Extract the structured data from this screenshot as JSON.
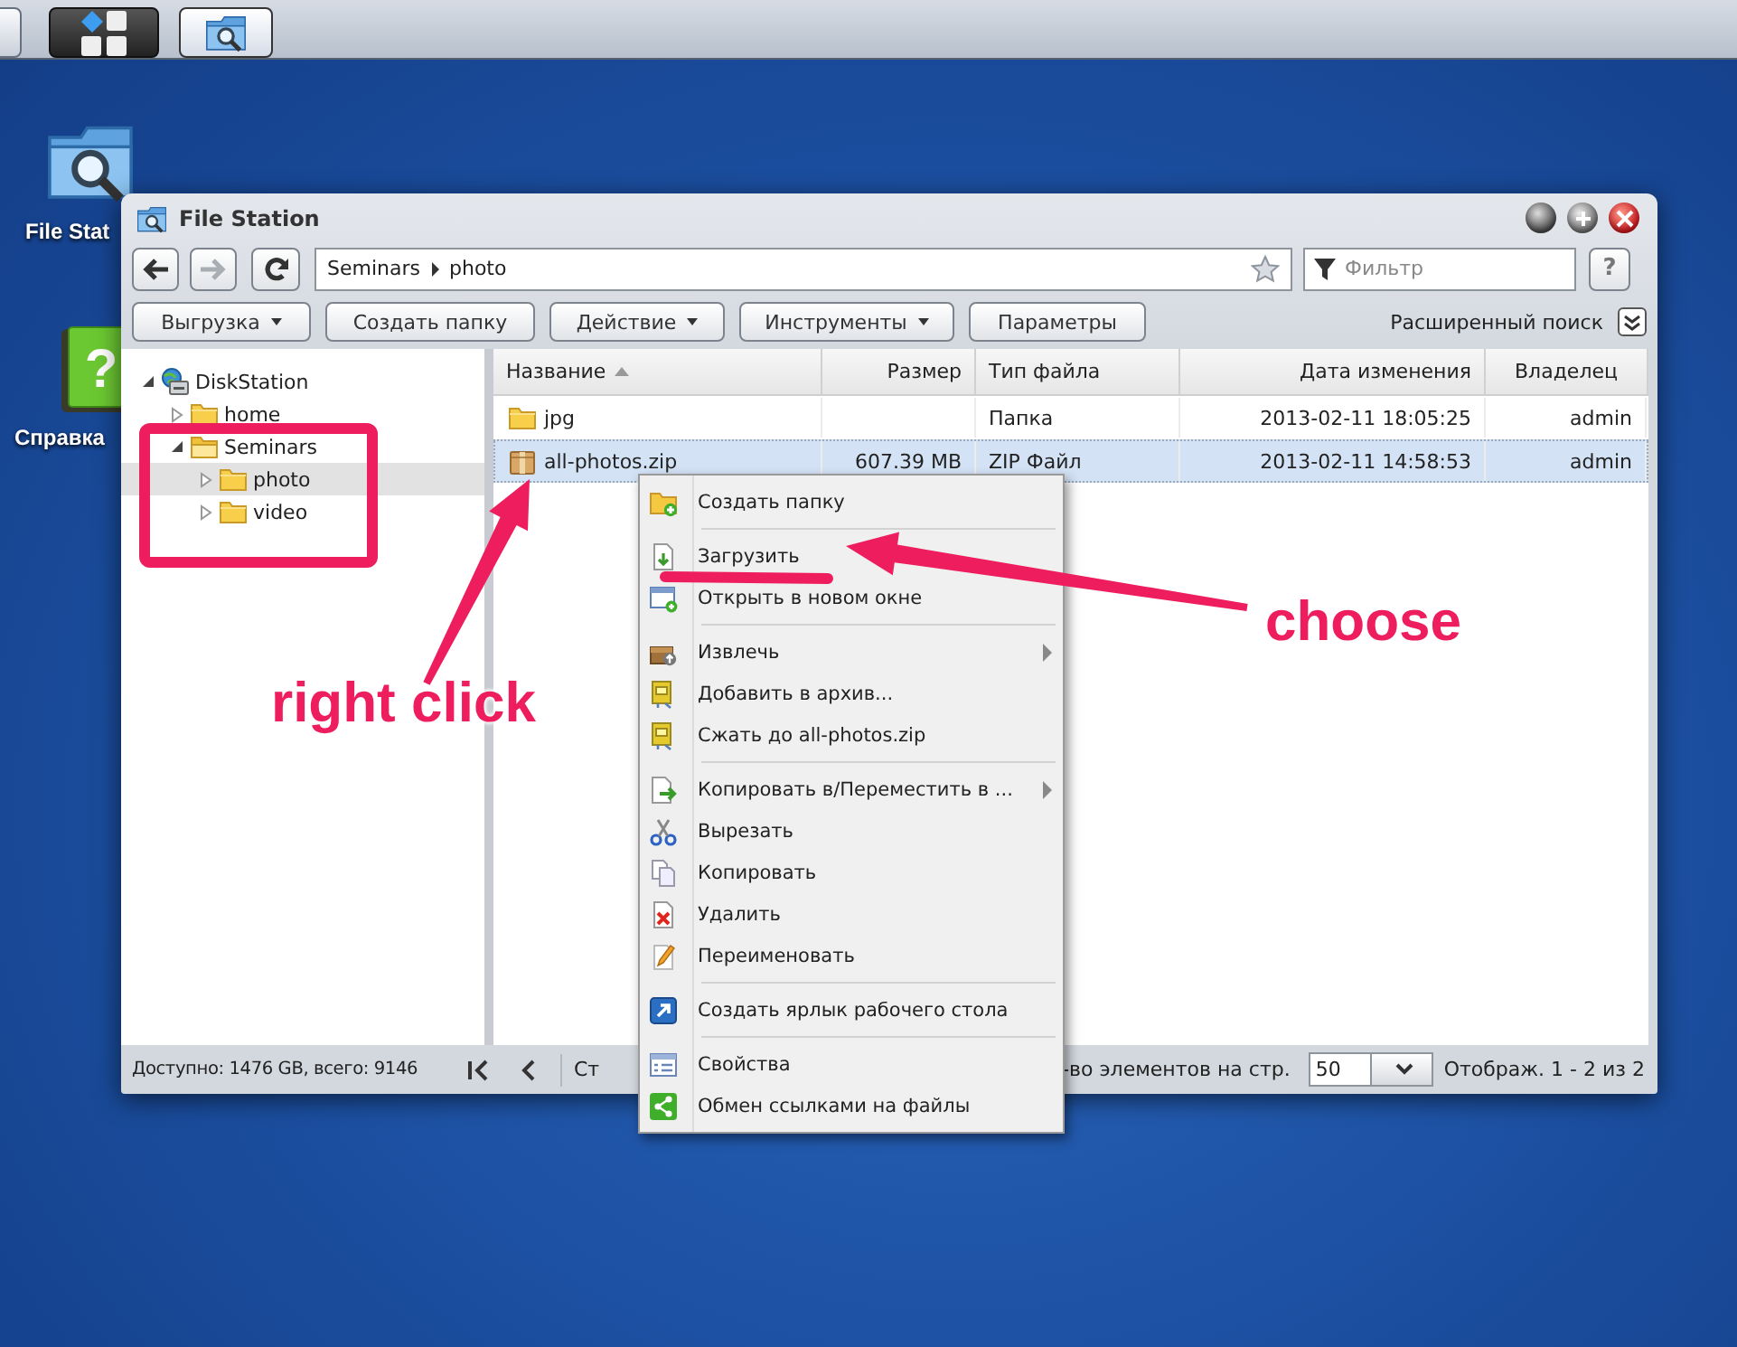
{
  "desktop_icons": [
    {
      "kind": "file-station",
      "label": "File Stat"
    },
    {
      "kind": "help",
      "label": "Справка",
      "glyph": "?"
    }
  ],
  "window": {
    "title": "File Station",
    "nav_buttons": [
      {
        "kind": "back",
        "disabled": false
      },
      {
        "kind": "forward",
        "disabled": true
      },
      {
        "kind": "refresh",
        "disabled": false
      }
    ],
    "path": [
      "Seminars",
      "photo"
    ],
    "filter": {
      "placeholder": "Фильтр"
    },
    "help": "?",
    "toolbar": {
      "buttons": [
        {
          "label": "Выгрузка",
          "dropdown": true
        },
        {
          "label": "Создать папку",
          "dropdown": false
        },
        {
          "label": "Действие",
          "dropdown": true
        },
        {
          "label": "Инструменты",
          "dropdown": true
        },
        {
          "label": "Параметры",
          "dropdown": false
        }
      ],
      "advanced_search": "Расширенный поиск"
    },
    "tree": [
      {
        "label": "DiskStation",
        "kind": "server",
        "expanded": true,
        "selected": false,
        "children": [
          {
            "label": "home",
            "kind": "folder",
            "expanded": false,
            "selected": false
          },
          {
            "label": "Seminars",
            "kind": "folder",
            "expanded": true,
            "selected": false,
            "children": [
              {
                "label": "photo",
                "kind": "folder",
                "expanded": false,
                "selected": true
              },
              {
                "label": "video",
                "kind": "folder",
                "expanded": false,
                "selected": false
              }
            ]
          }
        ]
      }
    ],
    "table": {
      "columns": [
        {
          "label": "Название",
          "sorted": true
        },
        {
          "label": "Размер",
          "sorted": false
        },
        {
          "label": "Тип файла",
          "sorted": false
        },
        {
          "label": "Дата изменения",
          "sorted": false
        },
        {
          "label": "Владелец",
          "sorted": false
        }
      ],
      "rows": [
        {
          "kind": "folder",
          "selected": false,
          "name": "jpg",
          "type": "Папка",
          "modified": "2013-02-11 18:05:25",
          "owner": "admin"
        },
        {
          "kind": "zip",
          "selected": true,
          "name": "all-photos.zip",
          "size": "607.39 MB",
          "type": "ZIP Файл",
          "modified": "2013-02-11 14:58:53",
          "owner": "admin"
        }
      ]
    },
    "status_bar": {
      "storage": "Доступно: 1476 GB, всего: 9146",
      "page_label": "Ст",
      "page_size_label": "-во элементов на стр.",
      "page_size": "50",
      "range": "Отображ. 1 - 2 из 2"
    }
  },
  "context_menu": {
    "groups": [
      [
        {
          "label": "Создать папку",
          "kind": "new-folder",
          "submenu": false
        }
      ],
      [
        {
          "label": "Загрузить",
          "kind": "download",
          "submenu": false
        },
        {
          "label": "Открыть в новом окне",
          "kind": "new-window",
          "submenu": false
        }
      ],
      [
        {
          "label": "Извлечь",
          "kind": "extract",
          "submenu": true
        },
        {
          "label": "Добавить в архив...",
          "kind": "archive",
          "submenu": false
        },
        {
          "label": "Сжать до all-photos.zip",
          "kind": "archive",
          "submenu": false
        }
      ],
      [
        {
          "label": "Копировать в/Переместить в ...",
          "kind": "copy-move",
          "submenu": true
        },
        {
          "label": "Вырезать",
          "kind": "cut",
          "submenu": false
        },
        {
          "label": "Копировать",
          "kind": "copy",
          "submenu": false
        },
        {
          "label": "Удалить",
          "kind": "delete",
          "submenu": false
        },
        {
          "label": "Переименовать",
          "kind": "rename",
          "submenu": false
        }
      ],
      [
        {
          "label": "Создать ярлык рабочего стола",
          "kind": "shortcut",
          "submenu": false
        }
      ],
      [
        {
          "label": "Свойства",
          "kind": "properties",
          "submenu": false
        },
        {
          "label": "Обмен ссылками на файлы",
          "kind": "share",
          "submenu": false
        }
      ]
    ]
  },
  "annotations": {
    "right_click": "right click",
    "choose": "choose"
  }
}
